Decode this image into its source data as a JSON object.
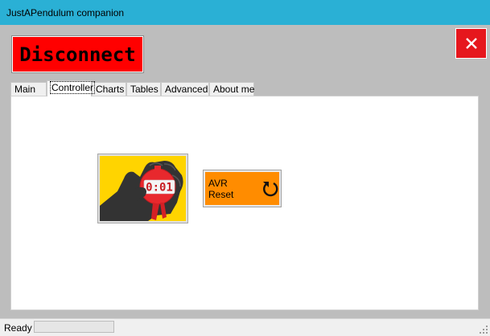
{
  "window": {
    "title": "JustAPendulum companion"
  },
  "toolbar": {
    "disconnect_label": "Disconnect",
    "close_icon": "close-icon"
  },
  "tabs": [
    {
      "label": "Main"
    },
    {
      "label": "Controller",
      "selected": true
    },
    {
      "label": "Charts"
    },
    {
      "label": "Tables"
    },
    {
      "label": "Advanced"
    },
    {
      "label": "About me"
    }
  ],
  "controller": {
    "timer": {
      "icon": "stopwatch-hand-icon",
      "display": "0:01"
    },
    "avr_reset": {
      "label": "AVR Reset",
      "icon": "reset-icon"
    }
  },
  "status": {
    "text": "Ready",
    "progress": 0
  },
  "colors": {
    "titlebar": "#2ab0d5",
    "disconnect": "#ff0000",
    "close": "#e6171d",
    "reset": "#ff8c00",
    "timer_bg": "#ffd400"
  }
}
